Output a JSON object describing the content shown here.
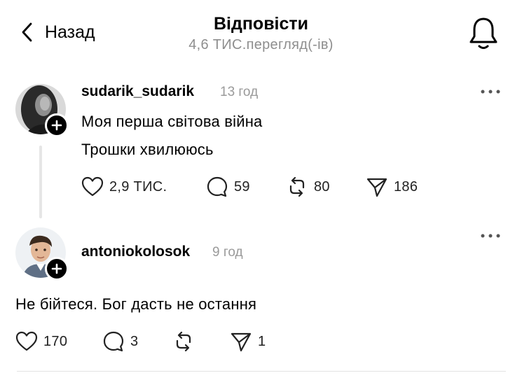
{
  "header": {
    "back_label": "Назад",
    "title": "Відповісти",
    "views": "4,6 ТИС.перегляд(-ів)"
  },
  "posts": [
    {
      "username": "sudarik_sudarik",
      "time": "13 год",
      "lines": [
        "Моя перша світова війна",
        "Трошки хвилююсь"
      ],
      "likes": "2,9 ТИС.",
      "comments": "59",
      "reposts": "80",
      "shares": "186"
    },
    {
      "username": "antoniokolosok",
      "time": "9 год",
      "lines": [
        "Не бійтеся. Бог дасть не остання"
      ],
      "likes": "170",
      "comments": "3",
      "reposts": "",
      "shares": "1"
    }
  ]
}
